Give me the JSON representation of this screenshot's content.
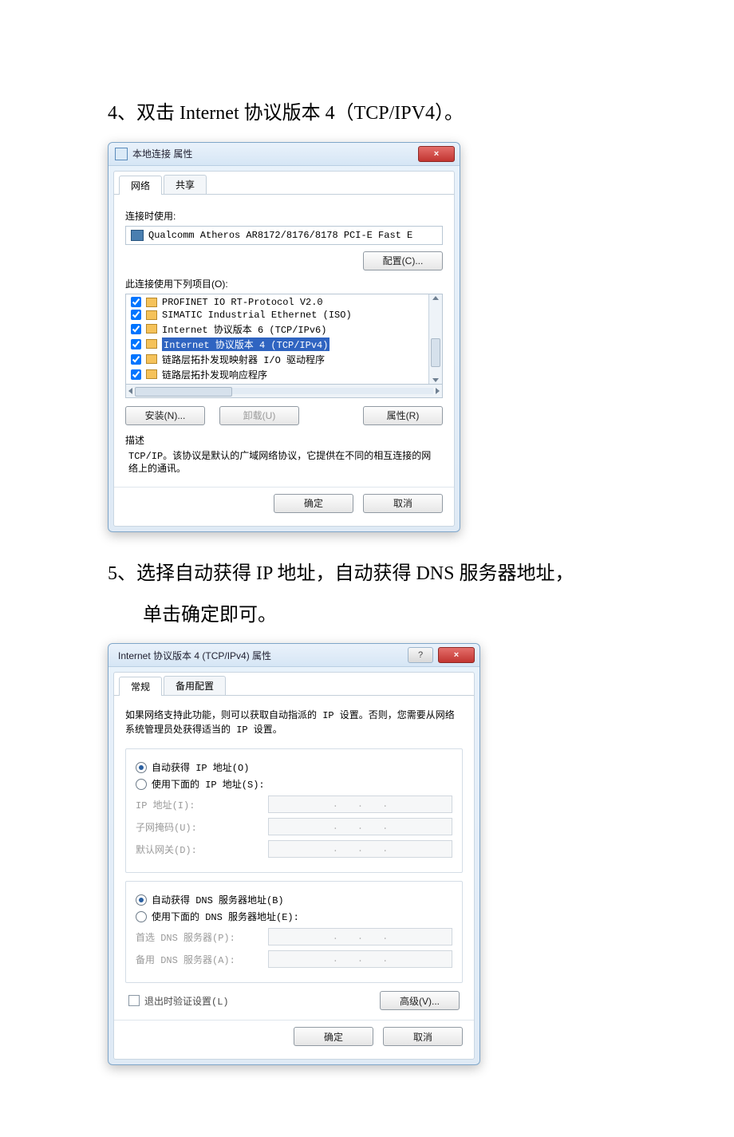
{
  "step4": "4、双击 Internet 协议版本 4（TCP/IPV4）。",
  "step5a": "5、选择自动获得 IP 地址，自动获得 DNS 服务器地址，",
  "step5b": "单击确定即可。",
  "dlg1": {
    "title": "本地连接 属性",
    "closeX": "×",
    "tabs": {
      "network": "网络",
      "share": "共享"
    },
    "useLabel": "连接时使用:",
    "adapter": "Qualcomm Atheros AR8172/8176/8178 PCI-E Fast E",
    "configure": "配置(C)...",
    "itemsLabel": "此连接使用下列项目(O):",
    "items": [
      "PROFINET IO RT-Protocol V2.0",
      "SIMATIC Industrial Ethernet (ISO)",
      "Internet 协议版本 6 (TCP/IPv6)",
      "Internet 协议版本 4 (TCP/IPv4)",
      "链路层拓扑发现映射器 I/O 驱动程序",
      "链路层拓扑发现响应程序"
    ],
    "install": "安装(N)...",
    "uninstall": "卸载(U)",
    "properties": "属性(R)",
    "descTitle": "描述",
    "desc": "TCP/IP。该协议是默认的广域网络协议，它提供在不同的相互连接的网络上的通讯。",
    "ok": "确定",
    "cancel": "取消"
  },
  "dlg2": {
    "title": "Internet 协议版本 4 (TCP/IPv4) 属性",
    "helpQ": "?",
    "closeX": "×",
    "tabs": {
      "general": "常规",
      "alt": "备用配置"
    },
    "note": "如果网络支持此功能，则可以获取自动指派的 IP 设置。否则，您需要从网络系统管理员处获得适当的 IP 设置。",
    "autoIP": "自动获得 IP 地址(O)",
    "manualIP": "使用下面的 IP 地址(S):",
    "ip": "IP 地址(I):",
    "mask": "子网掩码(U):",
    "gw": "默认网关(D):",
    "autoDNS": "自动获得 DNS 服务器地址(B)",
    "manualDNS": "使用下面的 DNS 服务器地址(E):",
    "dns1": "首选 DNS 服务器(P):",
    "dns2": "备用 DNS 服务器(A):",
    "validate": "退出时验证设置(L)",
    "advanced": "高级(V)...",
    "ok": "确定",
    "cancel": "取消"
  }
}
